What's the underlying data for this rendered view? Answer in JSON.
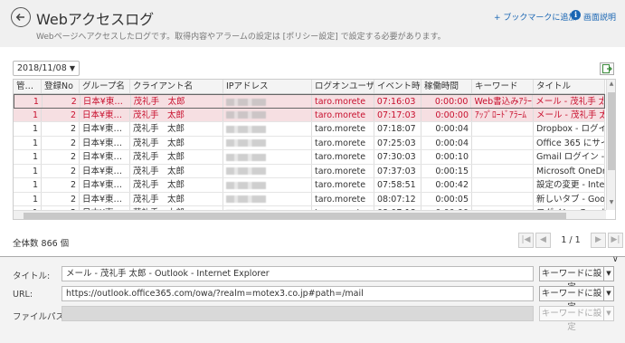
{
  "header": {
    "title": "Webアクセスログ",
    "description": "Webページへアクセスしたログです。取得内容やアラームの設定は [ポリシー設定] で設定する必要があります。",
    "bookmark_link": "+ ブックマークに追加",
    "help_link": "画面説明",
    "help_icon": "info-icon"
  },
  "toolbar": {
    "date_value": "2018/11/08",
    "export_icon": "export-excel-icon"
  },
  "grid": {
    "columns": [
      "管…",
      "登録No",
      "グループ名",
      "クライアント名",
      "IPアドレス",
      "ログオンユーザ…",
      "イベント時刻",
      "稼働時間",
      "キーワード",
      "タイトル"
    ],
    "rows": [
      {
        "kan": "1",
        "no": "2",
        "group": "日本¥東…",
        "client": "茂礼手　太郎",
        "user": "taro.morete",
        "time": "07:16:03",
        "dur": "0:00:00",
        "kw": "Web書込みｱﾗｰﾑ",
        "title": "メール - 茂礼手 太郎"
      },
      {
        "kan": "1",
        "no": "2",
        "group": "日本¥東…",
        "client": "茂礼手　太郎",
        "user": "taro.morete",
        "time": "07:17:03",
        "dur": "0:00:00",
        "kw": "ｱｯﾌﾟﾛｰﾄﾞｱﾗｰﾑ",
        "title": "メール - 茂礼手 太郎"
      },
      {
        "kan": "1",
        "no": "2",
        "group": "日本¥東…",
        "client": "茂礼手　太郎",
        "user": "taro.morete",
        "time": "07:18:07",
        "dur": "0:00:04",
        "kw": "",
        "title": "Dropbox - ログイン"
      },
      {
        "kan": "1",
        "no": "2",
        "group": "日本¥東…",
        "client": "茂礼手　太郎",
        "user": "taro.morete",
        "time": "07:25:03",
        "dur": "0:00:04",
        "kw": "",
        "title": "Office 365 にサイン"
      },
      {
        "kan": "1",
        "no": "2",
        "group": "日本¥東…",
        "client": "茂礼手　太郎",
        "user": "taro.morete",
        "time": "07:30:03",
        "dur": "0:00:10",
        "kw": "",
        "title": "Gmail ログイン - Go"
      },
      {
        "kan": "1",
        "no": "2",
        "group": "日本¥東…",
        "client": "茂礼手　太郎",
        "user": "taro.morete",
        "time": "07:37:03",
        "dur": "0:00:15",
        "kw": "",
        "title": "Microsoft OneDrive"
      },
      {
        "kan": "1",
        "no": "2",
        "group": "日本¥東…",
        "client": "茂礼手　太郎",
        "user": "taro.morete",
        "time": "07:58:51",
        "dur": "0:00:42",
        "kw": "",
        "title": "設定の変更 - Inte"
      },
      {
        "kan": "1",
        "no": "2",
        "group": "日本¥東…",
        "client": "茂礼手　太郎",
        "user": "taro.morete",
        "time": "08:07:12",
        "dur": "0:00:05",
        "kw": "",
        "title": "新しいタブ - Googl"
      },
      {
        "kan": "1",
        "no": "2",
        "group": "日本¥東…",
        "client": "茂礼手　太郎",
        "user": "taro.morete",
        "time": "08:07:18",
        "dur": "0:00:00",
        "kw": "",
        "title": "ログイン - Google C"
      }
    ]
  },
  "footer": {
    "total_label": "全体数 866 個",
    "page_indicator": "1 / 1"
  },
  "detail": {
    "title_label": "タイトル:",
    "title_value": "メール - 茂礼手 太郎 - Outlook - Internet Explorer",
    "url_label": "URL:",
    "url_value": "https://outlook.office365.com/owa/?realm=motex3.co.jp#path=/mail",
    "path_label": "ファイルパス:",
    "path_value": "",
    "kw_button": "キーワードに設定"
  }
}
